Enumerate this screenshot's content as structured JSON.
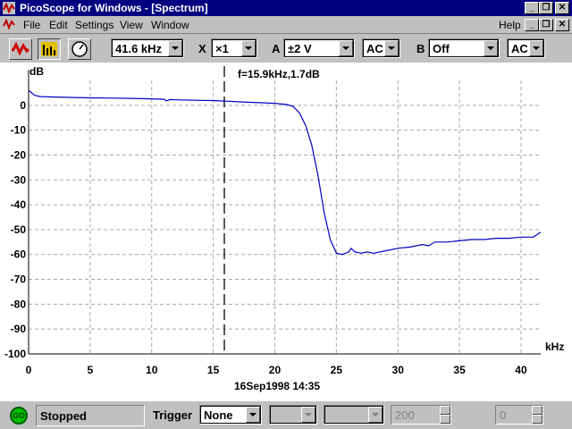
{
  "window": {
    "title": "PicoScope for Windows - [Spectrum]",
    "minimize_glyph": "_",
    "restore_glyph": "❐",
    "close_glyph": "✕"
  },
  "menu": {
    "items": [
      "File",
      "Edit",
      "Settings",
      "View",
      "Window"
    ],
    "help": "Help"
  },
  "toolbar": {
    "scope_icon": "scope-waveform-icon",
    "spectrum_icon": "spectrum-bars-icon",
    "meter_icon": "meter-dial-icon",
    "freq_range": "41.6 kHz",
    "x_label": "X",
    "x_mult": "×1",
    "a_label": "A",
    "a_range": "±2 V",
    "a_coupling": "AC",
    "b_label": "B",
    "b_range": "Off",
    "b_coupling": "AC"
  },
  "plot": {
    "y_unit": "dB",
    "x_unit": "kHz",
    "cursor_readout": "f=15.9kHz,1.7dB",
    "timestamp": "16Sep1998  14:35"
  },
  "chart_data": {
    "type": "line",
    "xlabel": "kHz",
    "ylabel": "dB",
    "xlim": [
      0,
      41.6
    ],
    "ylim": [
      -100,
      10
    ],
    "xticks": [
      0,
      5,
      10,
      15,
      20,
      25,
      30,
      35,
      40
    ],
    "yticks": [
      0,
      -10,
      -20,
      -30,
      -40,
      -50,
      -60,
      -70,
      -80,
      -90,
      -100
    ],
    "grid": true,
    "cursor_x": 15.9,
    "series": [
      {
        "color": "#0000c0",
        "x": [
          0,
          0.5,
          1,
          3,
          5,
          8,
          10,
          11,
          11.2,
          11.5,
          12,
          13,
          14,
          15,
          15.9,
          17,
          18,
          19,
          20,
          21,
          21.5,
          22,
          22.5,
          23,
          23.5,
          24,
          24.5,
          25,
          25.5,
          26,
          26.2,
          26.5,
          27,
          27.5,
          28,
          29,
          30,
          31,
          32,
          32.5,
          33,
          34,
          35,
          36,
          37,
          38,
          39,
          40,
          41,
          41.6
        ],
        "y": [
          6,
          4,
          3.5,
          3.2,
          3,
          2.8,
          2.6,
          2.4,
          1.8,
          2.3,
          2.2,
          2.1,
          2,
          1.9,
          1.7,
          1.4,
          1.2,
          1,
          0.8,
          0.3,
          -0.5,
          -3,
          -8,
          -16,
          -28,
          -43,
          -54,
          -59.5,
          -60,
          -59,
          -57.5,
          -59,
          -59.5,
          -59,
          -59.5,
          -58.5,
          -57.5,
          -57,
          -56,
          -56.5,
          -55,
          -55,
          -54.5,
          -54,
          -54,
          -53.5,
          -53.5,
          -53,
          -53,
          -51
        ]
      }
    ]
  },
  "status": {
    "go_label": "GO",
    "state": "Stopped",
    "trigger_label": "Trigger",
    "trigger_mode": "None",
    "trigger_level": "200",
    "delay": "0"
  }
}
